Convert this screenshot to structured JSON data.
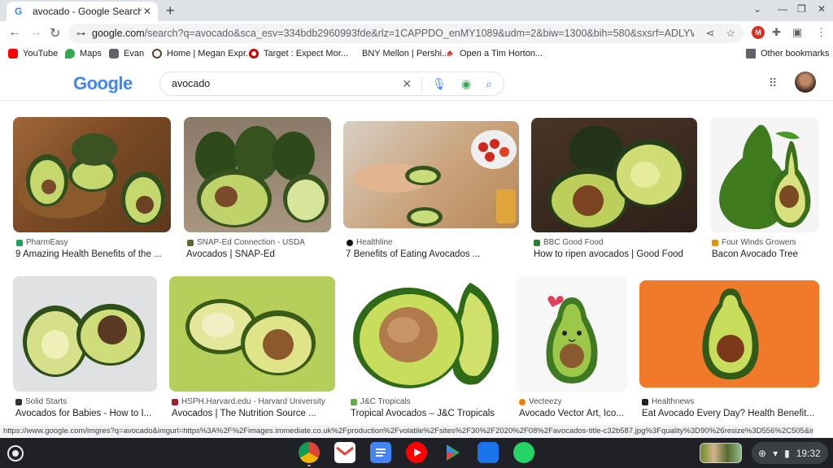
{
  "browser": {
    "tab_title": "avocado - Google Search",
    "tab_favicon": "G",
    "url_domain": "google.com",
    "url_rest": "/search?q=avocado&sca_esv=334bdb2960993fde&rlz=1CAPPDO_enMY1089&udm=2&biw=1300&bih=580&sxsrf=ADLYWILYZI_LLRpBj_filsR..."
  },
  "bookmarks": {
    "items": [
      "YouTube",
      "Maps",
      "Evan",
      "Home | Megan Expr...",
      "Target : Expect Mor...",
      "BNY Mellon | Pershi...",
      "Open a Tim Horton..."
    ],
    "other": "Other bookmarks"
  },
  "google": {
    "logo": "Google",
    "query": "avocado"
  },
  "results": [
    {
      "source": "PharmEasy",
      "title": "9 Amazing Health Benefits of the ...",
      "icon_color": "#1aa260"
    },
    {
      "source": "SNAP-Ed Connection - USDA",
      "title": "Avocados | SNAP-Ed",
      "icon_color": "#556b2f"
    },
    {
      "source": "Healthline",
      "title": "7 Benefits of Eating Avocados ...",
      "icon_color": "#111111"
    },
    {
      "source": "BBC Good Food",
      "title": "How to ripen avocados | Good Food",
      "icon_color": "#2e7d32"
    },
    {
      "source": "Four Winds Growers",
      "title": "Bacon Avocado Tree",
      "icon_color": "#e69500"
    },
    {
      "source": "Solid Starts",
      "title": "Avocados for Babies - How to I...",
      "icon_color": "#333333"
    },
    {
      "source": "HSPH.Harvard.edu - Harvard University",
      "title": "Avocados | The Nutrition Source ...",
      "icon_color": "#a51c30"
    },
    {
      "source": "J&C Tropicals",
      "title": "Tropical Avocados – J&C Tropicals",
      "icon_color": "#6aa84f"
    },
    {
      "source": "Vecteezy",
      "title": "Avocado Vector Art, Ico...",
      "icon_color": "#f57c00"
    },
    {
      "source": "Healthnews",
      "title": "Eat Avocado Every Day? Health Benefit...",
      "icon_color": "#222222"
    }
  ],
  "status_url": "https://www.google.com/imgres?q=avocado&imgurl=https%3A%2F%2Fimages.immediate.co.uk%2Fproduction%2Fvolatile%2Fsites%2F30%2F2020%2F08%2Favocados-title-c32b587.jpg%3Fquality%3D90%26resize%3D556%2C505&img...",
  "shelf": {
    "time": "19:32",
    "apps": [
      "chrome-icon",
      "gmail-icon",
      "docs-icon",
      "youtube-icon",
      "play-store-icon",
      "files-icon",
      "whatsapp-icon"
    ]
  }
}
